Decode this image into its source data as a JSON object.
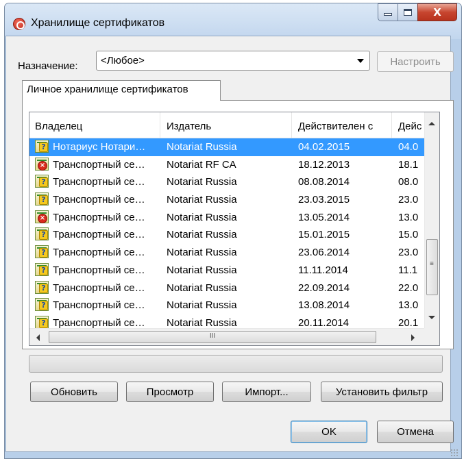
{
  "window": {
    "title": "Хранилище сертификатов",
    "close_glyph": "X"
  },
  "purpose": {
    "label": "Назначение:",
    "selected": "<Любое>"
  },
  "configure_button": "Настроить",
  "tab": {
    "label": "Личное хранилище сертификатов"
  },
  "table": {
    "columns": [
      "Владелец",
      "Издатель",
      "Действителен с",
      "Дейс"
    ],
    "rows": [
      {
        "owner": "Нотариус Нотари…",
        "issuer": "Notariat Russia",
        "from": "04.02.2015",
        "to": "04.0",
        "status": "unknown",
        "selected": true
      },
      {
        "owner": "Транспортный се…",
        "issuer": "Notariat RF CA",
        "from": "18.12.2013",
        "to": "18.1",
        "status": "invalid"
      },
      {
        "owner": "Транспортный се…",
        "issuer": "Notariat Russia",
        "from": "08.08.2014",
        "to": "08.0",
        "status": "unknown"
      },
      {
        "owner": "Транспортный се…",
        "issuer": "Notariat Russia",
        "from": "23.03.2015",
        "to": "23.0",
        "status": "unknown"
      },
      {
        "owner": "Транспортный се…",
        "issuer": "Notariat Russia",
        "from": "13.05.2014",
        "to": "13.0",
        "status": "invalid"
      },
      {
        "owner": "Транспортный се…",
        "issuer": "Notariat Russia",
        "from": "15.01.2015",
        "to": "15.0",
        "status": "unknown"
      },
      {
        "owner": "Транспортный се…",
        "issuer": "Notariat Russia",
        "from": "23.06.2014",
        "to": "23.0",
        "status": "unknown"
      },
      {
        "owner": "Транспортный се…",
        "issuer": "Notariat Russia",
        "from": "11.11.2014",
        "to": "11.1",
        "status": "unknown"
      },
      {
        "owner": "Транспортный се…",
        "issuer": "Notariat Russia",
        "from": "22.09.2014",
        "to": "22.0",
        "status": "unknown"
      },
      {
        "owner": "Транспортный се…",
        "issuer": "Notariat Russia",
        "from": "13.08.2014",
        "to": "13.0",
        "status": "unknown"
      },
      {
        "owner": "Транспортный се…",
        "issuer": "Notariat Russia",
        "from": "20.11.2014",
        "to": "20.1",
        "status": "unknown"
      }
    ],
    "hscroll_grip": "III",
    "vscroll_grip": "≡"
  },
  "buttons": {
    "refresh": "Обновить",
    "view": "Просмотр",
    "import": "Импорт...",
    "filter": "Установить фильтр",
    "ok": "OK",
    "cancel": "Отмена"
  },
  "colors": {
    "selection": "#3399ff",
    "window_frame": "#b8cfe9",
    "close_button": "#c7452f"
  }
}
